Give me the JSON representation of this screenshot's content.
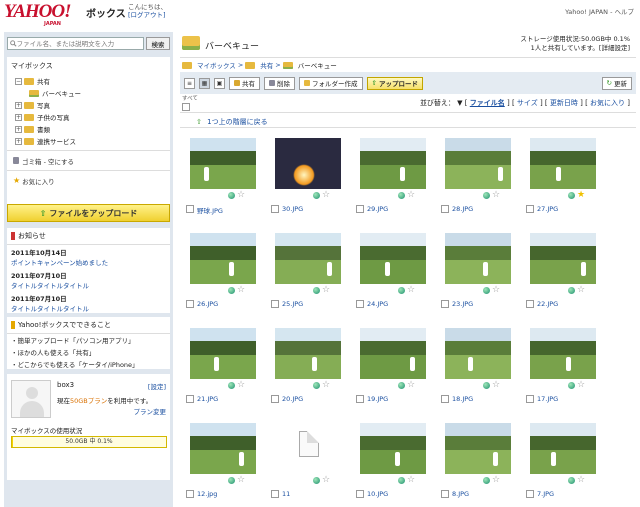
{
  "header": {
    "logo": "YAHOO!",
    "logo_sub": "JAPAN",
    "service": "ボックス",
    "greeting_line1": "こんにちは、",
    "greeting_line2": "[ログアウト]",
    "top_links": "Yahoo! JAPAN - ヘルプ"
  },
  "search": {
    "placeholder": "ファイル名、または説明文を入力",
    "button": "検索"
  },
  "mybox": {
    "title": "マイボックス",
    "tree": [
      {
        "label": "共有",
        "toggle": "−",
        "indent": 0
      },
      {
        "label": "バーベキュー",
        "toggle": "",
        "indent": 1
      },
      {
        "label": "写真",
        "toggle": "+",
        "indent": 0
      },
      {
        "label": "子供の写真",
        "toggle": "+",
        "indent": 0
      },
      {
        "label": "書類",
        "toggle": "+",
        "indent": 0
      },
      {
        "label": "連携サービス",
        "toggle": "+",
        "indent": 0
      }
    ],
    "trash": "ゴミ箱 - 空にする",
    "favorites": "お気に入り"
  },
  "upload_button": "ファイルをアップロード",
  "news": {
    "title": "お知らせ",
    "items": [
      {
        "date": "2011年10月14日",
        "text": "ポイントキャンペーン始めました"
      },
      {
        "date": "2011年07月10日",
        "text": "タイトルタイトルタイトル"
      },
      {
        "date": "2011年07月10日",
        "text": "タイトルタイトルタイトル"
      }
    ]
  },
  "features": {
    "title": "Yahoo!ボックスでできること",
    "lines": [
      "・簡単アップロード「パソコン用アプリ」",
      "・ほかの人も使える「共有」",
      "・どこからでも使える「ケータイ/iPhone」"
    ]
  },
  "profile": {
    "username": "box3",
    "settings": "[設定]",
    "plan_prefix": "現在",
    "plan_name": "50GBプラン",
    "plan_suffix": "を利用中です。",
    "plan_change": "プラン変更",
    "usage_label": "マイボックスの使用状況",
    "usage_text": "50.0GB 中 0.1%",
    "usage_fraction": 0.001
  },
  "main": {
    "folder_title": "バーベキュー",
    "storage_line1": "ストレージ使用状況:50.0GB中 0.1%",
    "storage_line2": "1人と共有しています。[詳細設定]",
    "breadcrumb": [
      "マイボックス",
      "共有",
      "バーベキュー"
    ],
    "toolbar": {
      "share": "共有",
      "delete": "削除",
      "new_folder": "フォルダー作成",
      "upload": "アップロード",
      "refresh": "更新"
    },
    "select_all": "すべて",
    "sort": {
      "label": "並び替え：",
      "options": [
        "ファイル名",
        "サイズ",
        "更新日時",
        "お気に入り"
      ]
    },
    "up_level": "1つ上の階層に戻る"
  },
  "files": [
    {
      "name": "野球.JPG",
      "fav": false,
      "kind": "photo"
    },
    {
      "name": "30.JPG",
      "fav": false,
      "kind": "night"
    },
    {
      "name": "29.JPG",
      "fav": false,
      "kind": "photo"
    },
    {
      "name": "28.JPG",
      "fav": false,
      "kind": "photo"
    },
    {
      "name": "27.JPG",
      "fav": true,
      "kind": "photo"
    },
    {
      "name": "26.JPG",
      "fav": false,
      "kind": "photo"
    },
    {
      "name": "25.JPG",
      "fav": false,
      "kind": "photo"
    },
    {
      "name": "24.JPG",
      "fav": false,
      "kind": "photo"
    },
    {
      "name": "23.JPG",
      "fav": false,
      "kind": "photo"
    },
    {
      "name": "22.JPG",
      "fav": false,
      "kind": "photo"
    },
    {
      "name": "21.JPG",
      "fav": false,
      "kind": "photo"
    },
    {
      "name": "20.JPG",
      "fav": false,
      "kind": "photo"
    },
    {
      "name": "19.JPG",
      "fav": false,
      "kind": "photo"
    },
    {
      "name": "18.JPG",
      "fav": false,
      "kind": "photo"
    },
    {
      "name": "17.JPG",
      "fav": false,
      "kind": "photo"
    },
    {
      "name": "12.jpg",
      "fav": false,
      "kind": "photo"
    },
    {
      "name": "11",
      "fav": false,
      "kind": "doc"
    },
    {
      "name": "10.JPG",
      "fav": false,
      "kind": "photo"
    },
    {
      "name": "8.JPG",
      "fav": false,
      "kind": "photo"
    },
    {
      "name": "7.JPG",
      "fav": false,
      "kind": "photo"
    }
  ],
  "icons": {
    "search": "search-icon",
    "folder": "folder-icon",
    "trash": "trash-icon",
    "star": "star-icon",
    "globe": "globe-icon"
  },
  "colors": {
    "sidebar_bg": "#dfe6ee",
    "upload_yellow": "#f0d030",
    "link_blue": "#1a4fa0",
    "logo_red": "#c8102e"
  }
}
